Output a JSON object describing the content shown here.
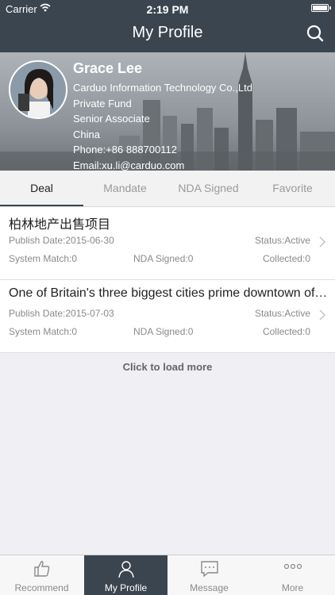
{
  "status_bar": {
    "carrier": "Carrier",
    "time": "2:19 PM"
  },
  "nav": {
    "title": "My Profile"
  },
  "profile": {
    "name": "Grace Lee",
    "company": "Carduo Information Technology Co.,Ltd",
    "fund": "Private Fund",
    "position": "Senior Associate",
    "country": "China",
    "phone": "Phone:+86 888700112",
    "email": "Email:xu.li@carduo.com"
  },
  "tabs": [
    "Deal",
    "Mandate",
    "NDA Signed",
    "Favorite"
  ],
  "deals": [
    {
      "title": "柏林地产出售项目",
      "publish": "Publish Date:2015-06-30",
      "status": "Status:Active",
      "match": "System Match:0",
      "nda": "NDA Signed:0",
      "collected": "Collected:0"
    },
    {
      "title": "One of Britain's three biggest cities prime downtown office building",
      "publish": "Publish Date:2015-07-03",
      "status": "Status:Active",
      "match": "System Match:0",
      "nda": "NDA Signed:0",
      "collected": "Collected:0"
    }
  ],
  "load_more": "Click to load more",
  "tabbar": [
    {
      "label": "Recommend",
      "icon": "thumbs-up-icon"
    },
    {
      "label": "My Profile",
      "icon": "person-icon"
    },
    {
      "label": "Message",
      "icon": "chat-icon"
    },
    {
      "label": "More",
      "icon": "ellipsis-icon"
    }
  ],
  "colors": {
    "header": "#3b4550",
    "background": "#efeff4"
  }
}
